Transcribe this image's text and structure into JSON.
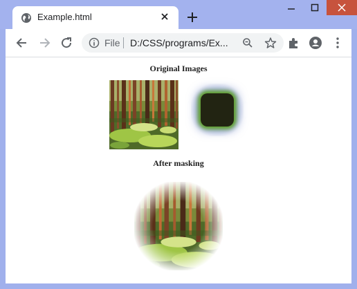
{
  "browser": {
    "tab_title": "Example.html",
    "omnibox_scheme": "File",
    "omnibox_url": "D:/CSS/programs/Ex...",
    "icons": {
      "favicon": "globe-icon",
      "close_tab": "close-icon",
      "new_tab": "plus-icon",
      "back": "arrow-left-icon",
      "forward": "arrow-right-icon",
      "reload": "reload-icon",
      "info": "info-icon",
      "zoom": "zoom-icon",
      "bookmark": "star-icon",
      "extensions": "puzzle-icon",
      "profile": "profile-icon",
      "menu": "kebab-menu-icon"
    }
  },
  "page": {
    "original_heading": "Original Images",
    "masked_heading": "After masking"
  },
  "colors": {
    "frame": "#a3b2ee",
    "close_button": "#c7533d",
    "accent_green": "#5fa02a"
  }
}
